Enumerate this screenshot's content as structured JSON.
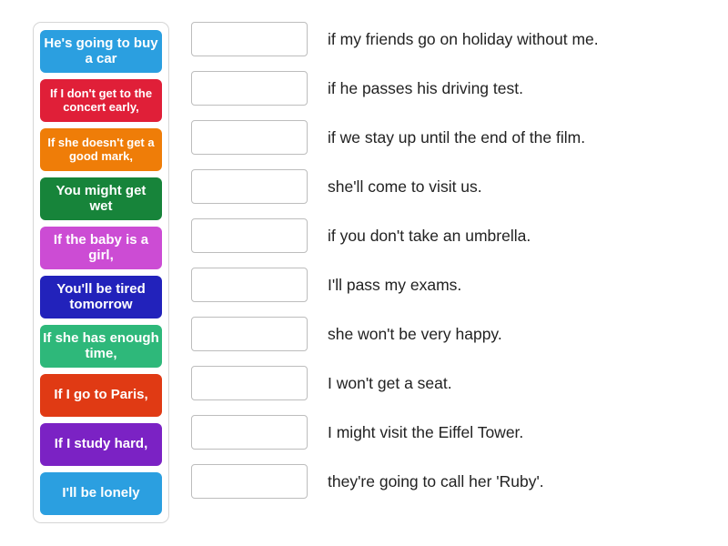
{
  "activity": {
    "type": "match-up",
    "instructions_visible": false
  },
  "tile_tray": {
    "name": "sentence-starters",
    "tiles": [
      {
        "label": "He's going to buy a car",
        "color": "#2b9fe0",
        "font_size": "15px"
      },
      {
        "label": "If I don't get to the concert early,",
        "color": "#e01f38",
        "font_size": "13px"
      },
      {
        "label": "If she doesn't get a good mark,",
        "color": "#ef7d08",
        "font_size": "13px"
      },
      {
        "label": "You might get wet",
        "color": "#17843a",
        "font_size": "15px"
      },
      {
        "label": "If the baby is a girl,",
        "color": "#cc4cd4",
        "font_size": "15px"
      },
      {
        "label": "You'll be tired tomorrow",
        "color": "#2222bb",
        "font_size": "15px"
      },
      {
        "label": "If she has enough time,",
        "color": "#2eb87a",
        "font_size": "15px"
      },
      {
        "label": "If I go to Paris,",
        "color": "#e03a14",
        "font_size": "15px"
      },
      {
        "label": "If I study hard,",
        "color": "#7b22c4",
        "font_size": "15px"
      },
      {
        "label": "I'll be lonely",
        "color": "#2b9fe0",
        "font_size": "15px"
      }
    ]
  },
  "answers": {
    "drop_zone_value": "",
    "rows": [
      {
        "text": "if my friends go on holiday without me."
      },
      {
        "text": "if he passes his driving test."
      },
      {
        "text": "if we stay up until the end of the film."
      },
      {
        "text": "she'll come to visit us."
      },
      {
        "text": "if you don't take an umbrella."
      },
      {
        "text": "I'll pass my exams."
      },
      {
        "text": "she won't be very happy."
      },
      {
        "text": "I won't get a seat."
      },
      {
        "text": "I might visit the Eiffel Tower."
      },
      {
        "text": "they're going to call her 'Ruby'."
      }
    ]
  }
}
